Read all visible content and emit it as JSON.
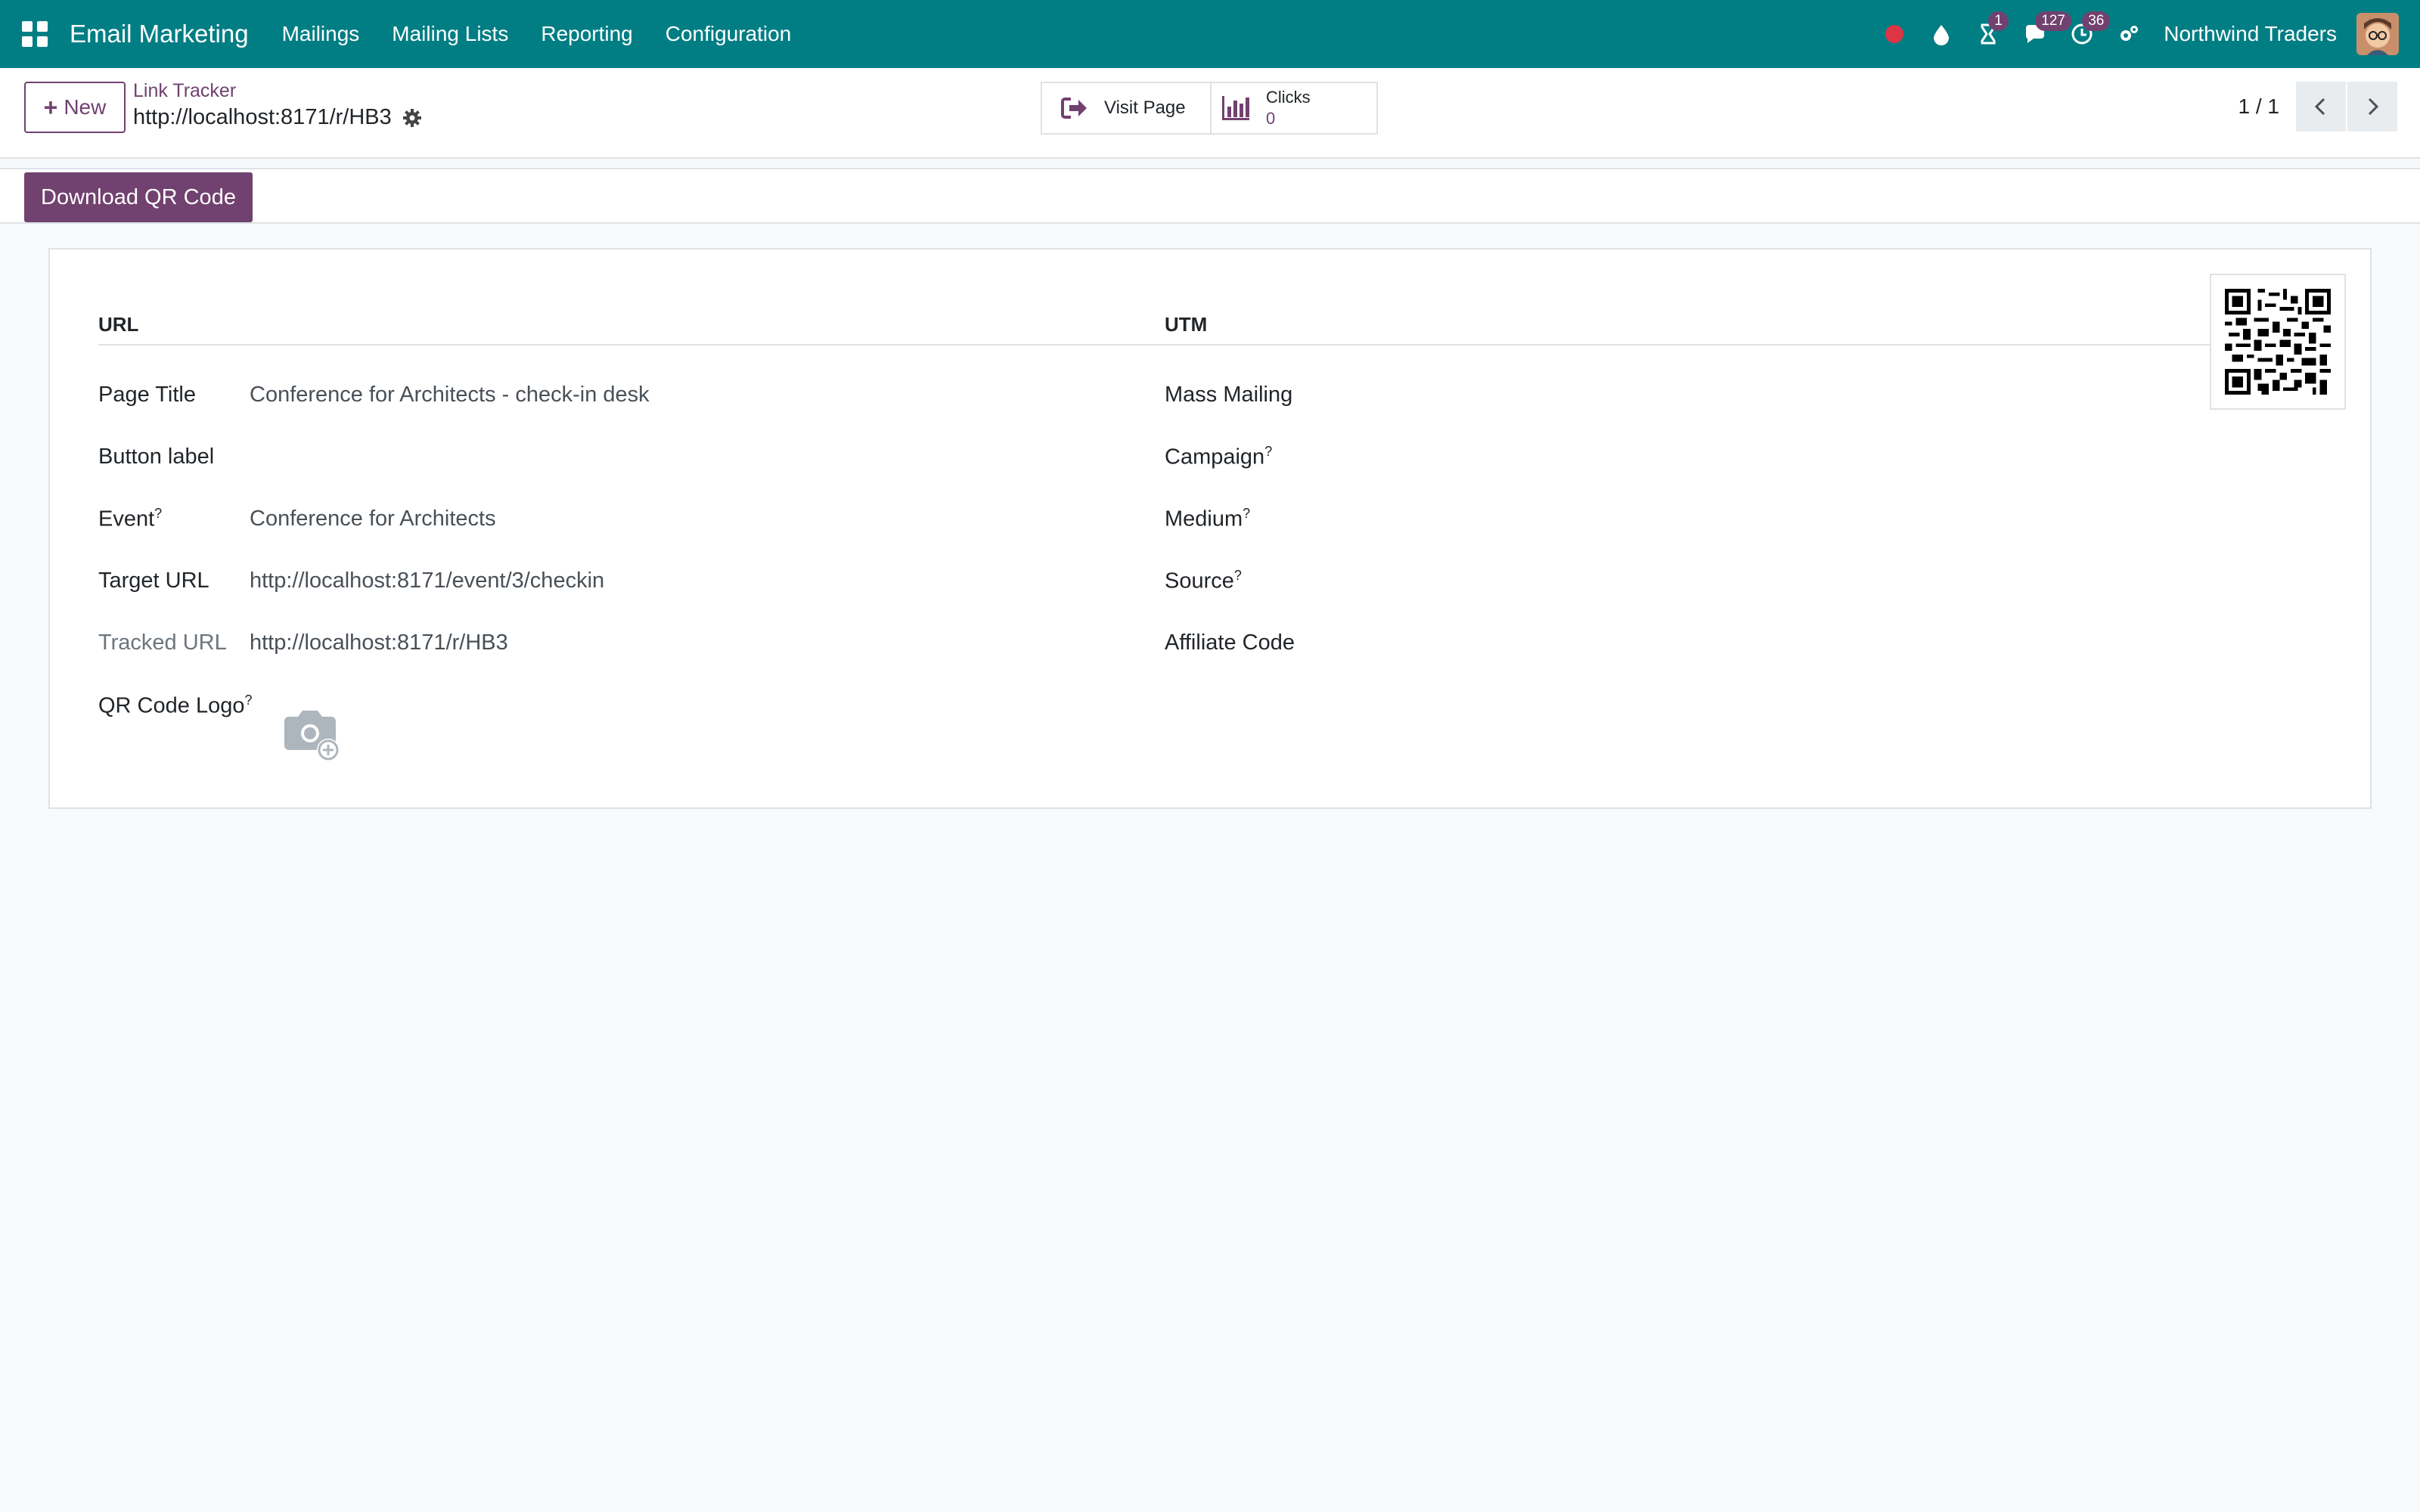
{
  "navbar": {
    "app_name": "Email Marketing",
    "menu": [
      "Mailings",
      "Mailing Lists",
      "Reporting",
      "Configuration"
    ],
    "activity_badge": "1",
    "messages_badge": "127",
    "clock_badge": "36",
    "company": "Northwind Traders",
    "bg_color": "#017e84"
  },
  "control_panel": {
    "new_label": "New",
    "breadcrumb_parent": "Link Tracker",
    "breadcrumb_current": "http://localhost:8171/r/HB3",
    "visit_page_label": "Visit Page",
    "clicks_label": "Clicks",
    "clicks_value": "0",
    "pager": "1 / 1"
  },
  "status_bar": {
    "qr_button": "Download QR Code",
    "accent_color": "#71416f"
  },
  "form": {
    "url_group": {
      "title": "URL",
      "page_title_label": "Page Title",
      "page_title_value": "Conference for Architects - check-in desk",
      "button_label_label": "Button label",
      "button_label_value": "",
      "event_label": "Event",
      "event_value": "Conference for Architects",
      "target_url_label": "Target URL",
      "target_url_value": "http://localhost:8171/event/3/checkin",
      "tracked_url_label": "Tracked URL",
      "tracked_url_value": "http://localhost:8171/r/HB3",
      "qr_logo_label": "QR Code Logo"
    },
    "utm_group": {
      "title": "UTM",
      "mass_mailing_label": "Mass Mailing",
      "campaign_label": "Campaign",
      "medium_label": "Medium",
      "source_label": "Source",
      "affiliate_code_label": "Affiliate Code"
    },
    "tooltip_marker": "?"
  }
}
